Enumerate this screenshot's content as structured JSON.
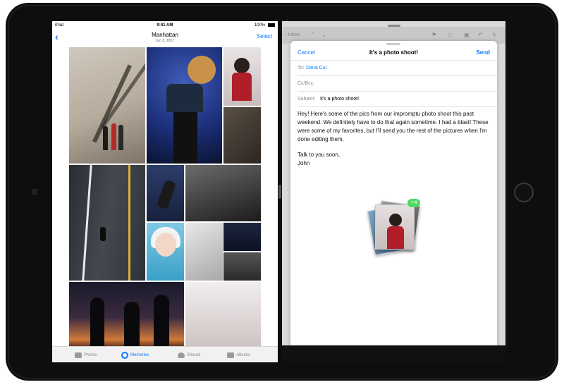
{
  "status_bar": {
    "carrier": "iPad",
    "time": "9:41 AM",
    "battery": "100%"
  },
  "photos": {
    "title": "Manhattan",
    "subtitle": "Jun 3, 2017",
    "select_label": "Select",
    "tabs": [
      {
        "label": "Photos",
        "icon": "photos-icon",
        "active": false
      },
      {
        "label": "Memories",
        "icon": "memories-icon",
        "active": true
      },
      {
        "label": "Shared",
        "icon": "cloud-icon",
        "active": false
      },
      {
        "label": "Albums",
        "icon": "albums-icon",
        "active": false
      }
    ]
  },
  "mail": {
    "toolbar": {
      "inbox_label": "Inbox"
    },
    "compose": {
      "cancel_label": "Cancel",
      "title": "It's a photo shoot!",
      "send_label": "Send",
      "to_label": "To:",
      "to_value": "Dana Cui",
      "cc_label": "Cc/Bcc:",
      "subject_label": "Subject:",
      "subject_value": "It's a photo shoot!",
      "body_paragraph_1": "Hey! Here's some of the pics from our impromptu photo shoot this past weekend. We definitely have to do that again sometime. I had a blast! These were some of my favorites, but I'll send you the rest of the pictures when I'm done editing them.",
      "body_closing": "Talk to you soon,",
      "body_signature": "John"
    },
    "drag": {
      "badge": "4"
    }
  },
  "colors": {
    "accent": "#0a7aff",
    "badge": "#4cd964"
  }
}
